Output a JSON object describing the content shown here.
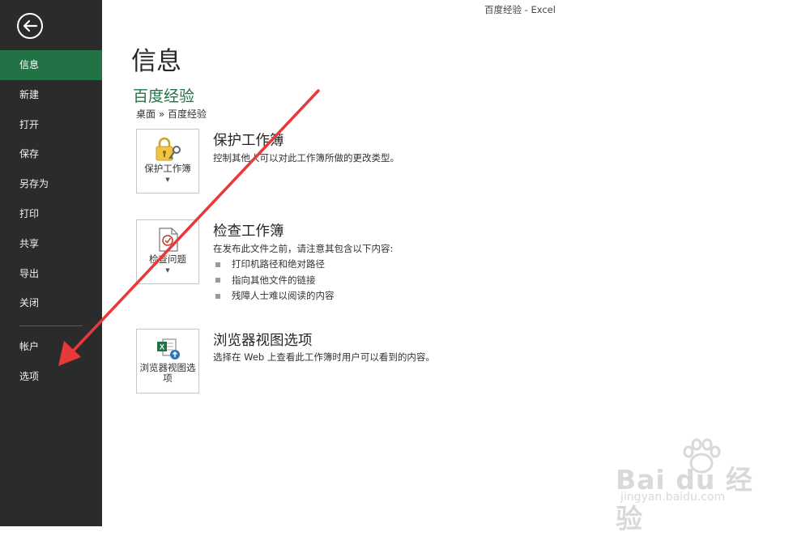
{
  "window": {
    "title": "百度经验 - Excel"
  },
  "sidebar": {
    "items": [
      {
        "label": "信息"
      },
      {
        "label": "新建"
      },
      {
        "label": "打开"
      },
      {
        "label": "保存"
      },
      {
        "label": "另存为"
      },
      {
        "label": "打印"
      },
      {
        "label": "共享"
      },
      {
        "label": "导出"
      },
      {
        "label": "关闭"
      }
    ],
    "bottom_items": [
      {
        "label": "帐户"
      },
      {
        "label": "选项"
      }
    ],
    "accent_color": "#217346"
  },
  "main": {
    "page_title": "信息",
    "doc_name": "百度经验",
    "doc_path": "桌面 » 百度经验",
    "sections": [
      {
        "tile_label": "保护工作簿",
        "title": "保护工作簿",
        "description": "控制其他人可以对此工作簿所做的更改类型。",
        "icon": "lock-key-icon"
      },
      {
        "tile_label": "检查问题",
        "title": "检查工作簿",
        "description": "在发布此文件之前，请注意其包含以下内容:",
        "bullets": [
          "打印机路径和绝对路径",
          "指向其他文件的链接",
          "残障人士难以阅读的内容"
        ],
        "icon": "check-document-icon"
      },
      {
        "tile_label": "浏览器视图选项",
        "title": "浏览器视图选项",
        "description": "选择在 Web 上查看此工作簿时用户可以看到的内容。",
        "icon": "excel-web-icon"
      }
    ]
  },
  "watermark": {
    "brand": "Bai du 经验",
    "site": "jingyan.baidu.com"
  },
  "annotation": {
    "color": "#e8393a",
    "icon": "red-arrow"
  }
}
